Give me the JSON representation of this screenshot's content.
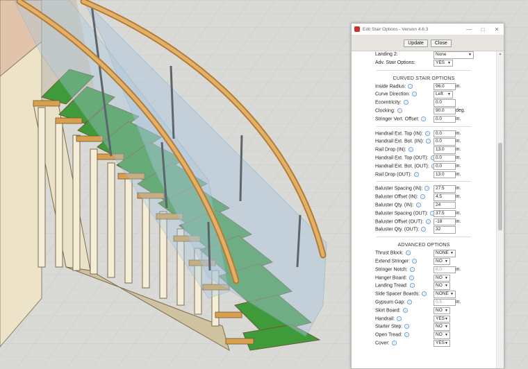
{
  "dialog": {
    "title": "Edit Stair Options - Version 4.6.3",
    "update_label": "Update",
    "close_label": "Close"
  },
  "top_rows": [
    {
      "label": "Landing 2:",
      "value": "None",
      "kind": "select",
      "w": 52
    },
    {
      "label": "Adv. Stair Options:",
      "value": "YES",
      "kind": "select",
      "w": 22
    }
  ],
  "curved_header": "CURVED STAIR OPTIONS",
  "curved_rows": [
    {
      "label": "Inside Radius:",
      "value": "96.0",
      "unit": "in."
    },
    {
      "label": "Curve Direction:",
      "value": "Left",
      "kind": "select",
      "w": 22
    },
    {
      "label": "Eccentricity:",
      "value": "0.0"
    },
    {
      "label": "Clocking:",
      "value": "90.0",
      "unit": "deg."
    },
    {
      "label": "Stringer Vert. Offset:",
      "value": "0.0",
      "unit": "in."
    }
  ],
  "handrail_rows": [
    {
      "label": "Handrail Ext. Top (IN):",
      "value": "0.0",
      "unit": "in."
    },
    {
      "label": "Handrail Ext. Bot. (IN):",
      "value": "0.0",
      "unit": "in."
    },
    {
      "label": "Rail Drop (IN):",
      "value": "13.0",
      "unit": "in."
    },
    {
      "label": "Handrail Ext. Top (OUT):",
      "value": "0.0",
      "unit": "in."
    },
    {
      "label": "Handrail Ext. Bot. (OUT):",
      "value": "0.0",
      "unit": "in."
    },
    {
      "label": "Rail Drop (OUT):",
      "value": "13.0",
      "unit": "in."
    }
  ],
  "baluster_rows": [
    {
      "label": "Baluster Spacing (IN):",
      "value": "27.5",
      "unit": "in."
    },
    {
      "label": "Baluster Offset (IN):",
      "value": "4.5",
      "unit": "in."
    },
    {
      "label": "Baluster Qty. (IN):",
      "value": "24"
    },
    {
      "label": "Baluster Spacing (OUT):",
      "value": "37.5",
      "unit": "in."
    },
    {
      "label": "Baluster Offset (OUT):",
      "value": "-18",
      "unit": "in."
    },
    {
      "label": "Baluster Qty. (OUT):",
      "value": "32"
    }
  ],
  "advanced_header": "ADVANCED OPTIONS",
  "advanced_rows": [
    {
      "label": "Thrust Block:",
      "value": "NONE",
      "kind": "select",
      "w": 26
    },
    {
      "label": "Extend Stringer:",
      "value": "NO",
      "kind": "select",
      "w": 18
    },
    {
      "label": "Stringer Notch:",
      "value": "6.0",
      "unit": "in.",
      "disabled": true
    },
    {
      "label": "Hanger Board:",
      "value": "NO",
      "kind": "select",
      "w": 18
    },
    {
      "label": "Landing Tread:",
      "value": "NO",
      "kind": "select",
      "w": 18
    },
    {
      "label": "Side Spacer Boards:",
      "value": "NONE",
      "kind": "select",
      "w": 26
    },
    {
      "label": "Gypsum Gap:",
      "value": "0.5",
      "unit": "in.",
      "disabled": true
    },
    {
      "label": "Skirt Board:",
      "value": "NO",
      "kind": "select",
      "w": 18
    },
    {
      "label": "Handrail:",
      "value": "YES",
      "kind": "select",
      "w": 18
    },
    {
      "label": "Starter Step:",
      "value": "NO",
      "kind": "select",
      "w": 18
    },
    {
      "label": "Open Tread:",
      "value": "NO",
      "kind": "select",
      "w": 18
    },
    {
      "label": "Cover:",
      "value": "YES",
      "kind": "select",
      "w": 18
    }
  ],
  "colors": {
    "tread_green": "#3f9a3a",
    "wood": "#d8a04d",
    "glass": "#a9c7df",
    "ground": "#d9d9d6",
    "wall": "#e8dcc2"
  }
}
